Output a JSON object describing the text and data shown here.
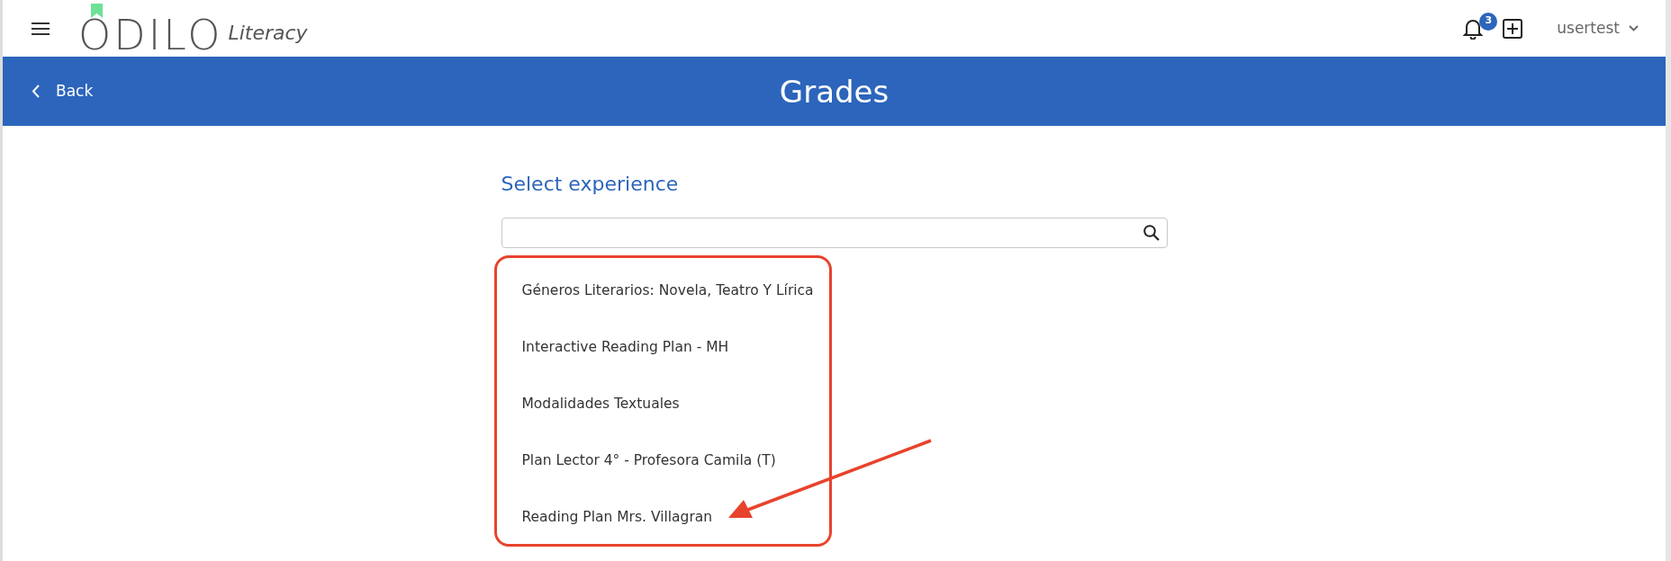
{
  "header": {
    "logo": "ODILO",
    "logo_suffix": "Literacy",
    "notifications_badge": "3",
    "user": "usertest"
  },
  "title_bar": {
    "back": "Back",
    "title": "Grades"
  },
  "section_title": "Select experience",
  "experiences": [
    {
      "label": "Géneros Literarios: Novela, Teatro Y Lírica"
    },
    {
      "label": "Interactive Reading Plan - MH"
    },
    {
      "label": "Modalidades Textuales"
    },
    {
      "label": "Plan Lector 4° - Profesora Camila (T)"
    },
    {
      "label": "Reading Plan Mrs. Villagran"
    }
  ]
}
